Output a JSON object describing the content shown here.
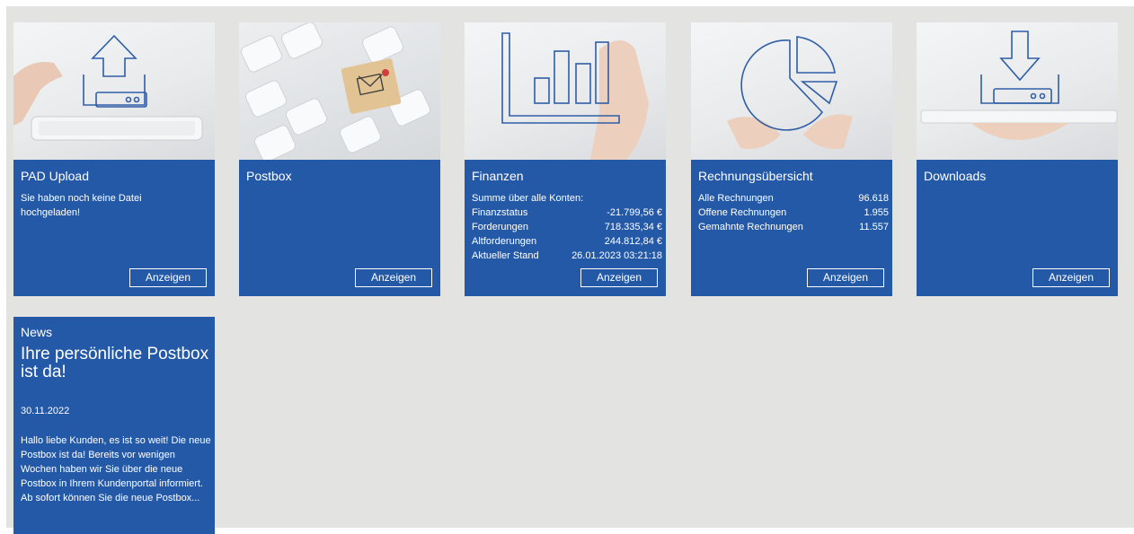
{
  "tiles": [
    {
      "title": "PAD Upload",
      "message": "Sie haben noch keine Datei hochgeladen!",
      "button": "Anzeigen",
      "icon": "upload-icon"
    },
    {
      "title": "Postbox",
      "button": "Anzeigen",
      "icon": "mail-icon"
    },
    {
      "title": "Finanzen",
      "summary_label": "Summe über alle Konten:",
      "rows": [
        {
          "label": "Finanzstatus",
          "value": "-21.799,56 €"
        },
        {
          "label": "Forderungen",
          "value": "718.335,34 €"
        },
        {
          "label": "Altforderungen",
          "value": "244.812,84 €"
        },
        {
          "label": "Aktueller Stand",
          "value": "26.01.2023 03:21:18"
        }
      ],
      "button": "Anzeigen",
      "icon": "bar-chart-icon"
    },
    {
      "title": "Rechnungsübersicht",
      "rows": [
        {
          "label": "Alle Rechnungen",
          "value": "96.618"
        },
        {
          "label": "Offene Rechnungen",
          "value": "1.955"
        },
        {
          "label": "Gemahnte Rechnungen",
          "value": "11.557"
        }
      ],
      "button": "Anzeigen",
      "icon": "pie-chart-icon"
    },
    {
      "title": "Downloads",
      "button": "Anzeigen",
      "icon": "download-icon"
    }
  ],
  "news": {
    "label": "News",
    "headline": "Ihre persönliche Postbox ist da!",
    "date": "30.11.2022",
    "text": "Hallo liebe Kunden, es ist so weit! Die neue Postbox ist da! Bereits vor wenigen Wochen haben wir Sie über die neue Postbox in Ihrem Kundenportal informiert. Ab sofort können Sie die neue Postbox..."
  },
  "colors": {
    "tile_blue": "#2459a8",
    "background": "#e3e3e1",
    "icon_stroke": "#2f5ea6"
  }
}
